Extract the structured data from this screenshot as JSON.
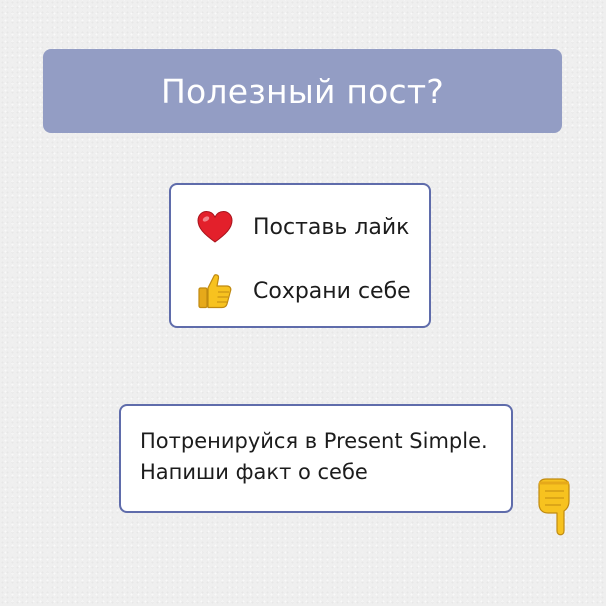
{
  "header": {
    "title": "Полезный пост?"
  },
  "actions": [
    {
      "icon": "heart-icon",
      "label": "Поставь лайк"
    },
    {
      "icon": "thumbs-up-icon",
      "label": "Сохрани себе"
    }
  ],
  "task": {
    "line1": "Потренируйся в Present Simple.",
    "line2": "Напиши факт о себе"
  },
  "pointer": {
    "icon": "pointing-down-hand-icon"
  },
  "colors": {
    "banner": "#939dc4",
    "card_border": "#5f6cab",
    "text": "#1c1c1c",
    "heart": "#e3202b",
    "hand": "#f7c21f"
  }
}
